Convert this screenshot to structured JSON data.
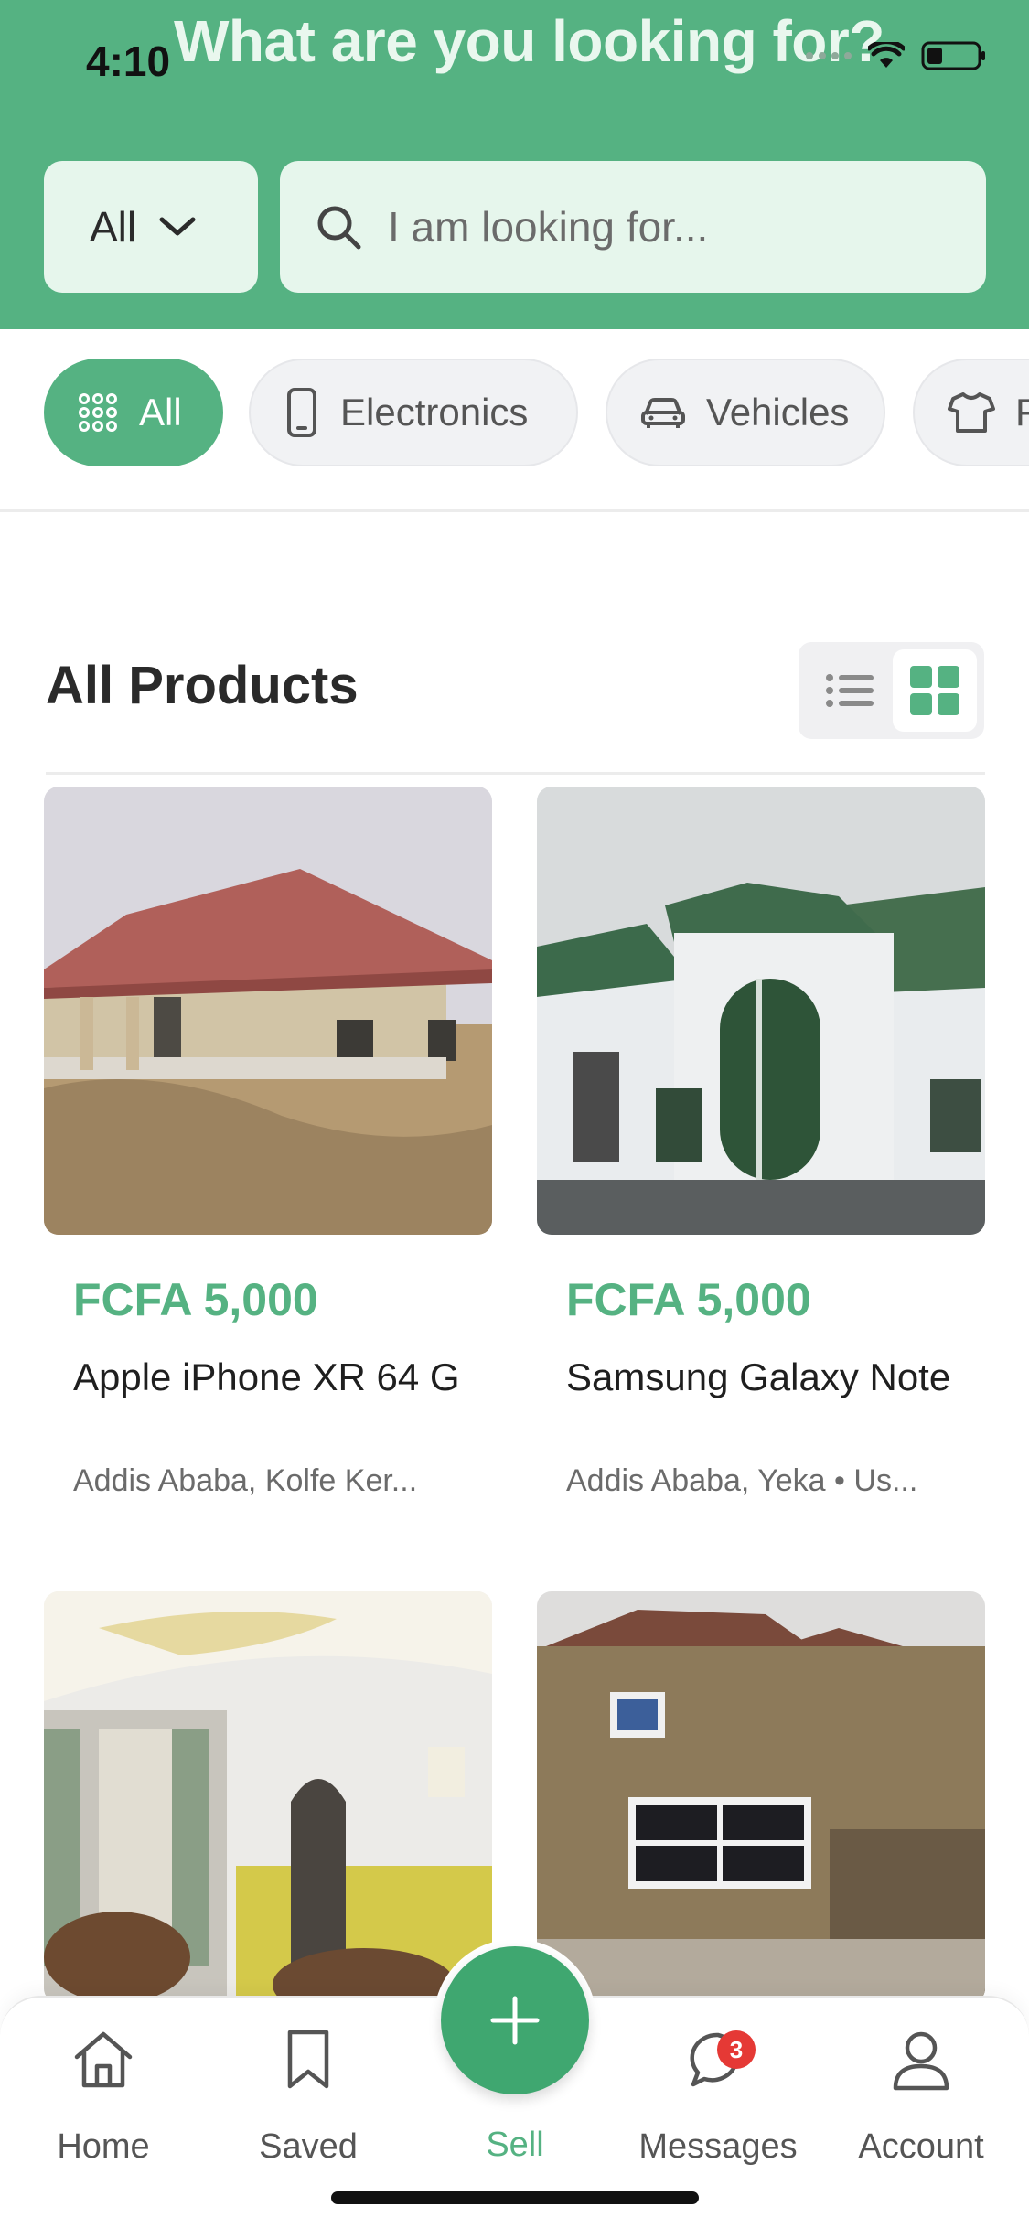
{
  "status_bar": {
    "time": "4:10"
  },
  "header": {
    "title": "What are you looking for?"
  },
  "filter": {
    "selected": "All"
  },
  "search": {
    "placeholder": "I am looking for..."
  },
  "categories": [
    {
      "label": "All",
      "icon": "grid-dots-icon",
      "active": true
    },
    {
      "label": "Electronics",
      "icon": "phone-icon",
      "active": false
    },
    {
      "label": "Vehicles",
      "icon": "car-icon",
      "active": false
    },
    {
      "label": "F",
      "icon": "shirt-icon",
      "active": false
    }
  ],
  "section": {
    "title": "All Products",
    "view_mode": "grid"
  },
  "products": [
    {
      "price": "FCFA 5,000",
      "title": "Apple iPhone XR 64 G",
      "location": "Addis Ababa, Kolfe Ker...",
      "image": "house-red-roof"
    },
    {
      "price": "FCFA 5,000",
      "title": "Samsung Galaxy Note",
      "location": "Addis Ababa, Yeka • Us...",
      "image": "house-green-roof"
    },
    {
      "image": "living-room-interior"
    },
    {
      "image": "house-brown-two-story"
    }
  ],
  "bottom_nav": {
    "items": [
      {
        "label": "Home",
        "icon": "home-icon"
      },
      {
        "label": "Saved",
        "icon": "bookmark-icon"
      },
      {
        "label": "Sell",
        "icon": "plus-icon"
      },
      {
        "label": "Messages",
        "icon": "chat-icon",
        "badge": "3"
      },
      {
        "label": "Account",
        "icon": "user-icon"
      }
    ]
  },
  "colors": {
    "primary": "#55b282",
    "header_bg": "#55b282",
    "field_bg": "#e6f6ec",
    "badge": "#e53935"
  }
}
